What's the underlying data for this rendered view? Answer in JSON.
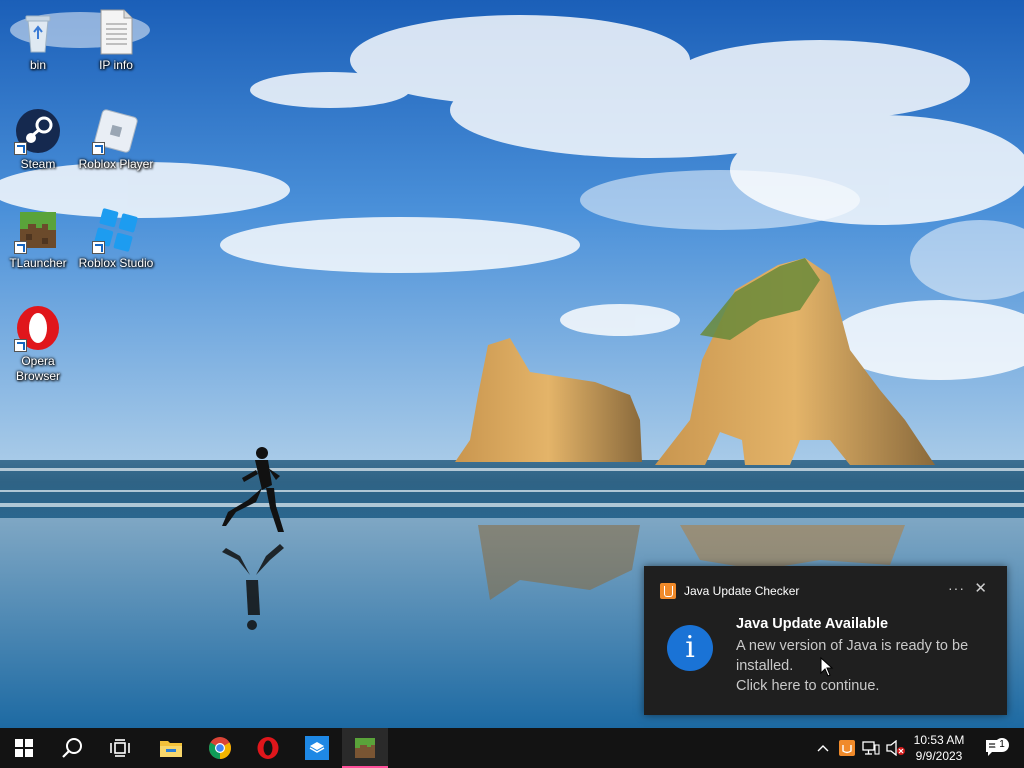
{
  "desktop": {
    "icons": [
      {
        "label": "bin",
        "icon": "recycle-bin-icon"
      },
      {
        "label": "IP info",
        "icon": "text-file-icon"
      },
      {
        "label": "Steam",
        "icon": "steam-icon"
      },
      {
        "label": "Roblox Player",
        "icon": "roblox-player-icon"
      },
      {
        "label": "TLauncher",
        "icon": "tlauncher-icon"
      },
      {
        "label": "Roblox Studio",
        "icon": "roblox-studio-icon"
      },
      {
        "label": "Opera Browser",
        "icon": "opera-icon"
      }
    ]
  },
  "toast": {
    "app_name": "Java Update Checker",
    "more": "···",
    "close": "✕",
    "icon_text": "i",
    "title": "Java Update Available",
    "body": "A new version of Java is ready to be installed.\nClick here to continue."
  },
  "taskbar": {
    "pinned": [
      "windows-start-icon",
      "search-icon",
      "task-view-icon",
      "file-explorer-icon",
      "chrome-icon",
      "opera-icon",
      "store-icon",
      "minecraft-icon"
    ],
    "clock": {
      "time": "10:53 AM",
      "date": "9/9/2023"
    },
    "notification_count": "1"
  },
  "colors": {
    "taskbar": "#131313",
    "toast_bg": "#1f1f1f",
    "accent_blue": "#1a73d6",
    "active_indicator": "#ff4f9a"
  }
}
